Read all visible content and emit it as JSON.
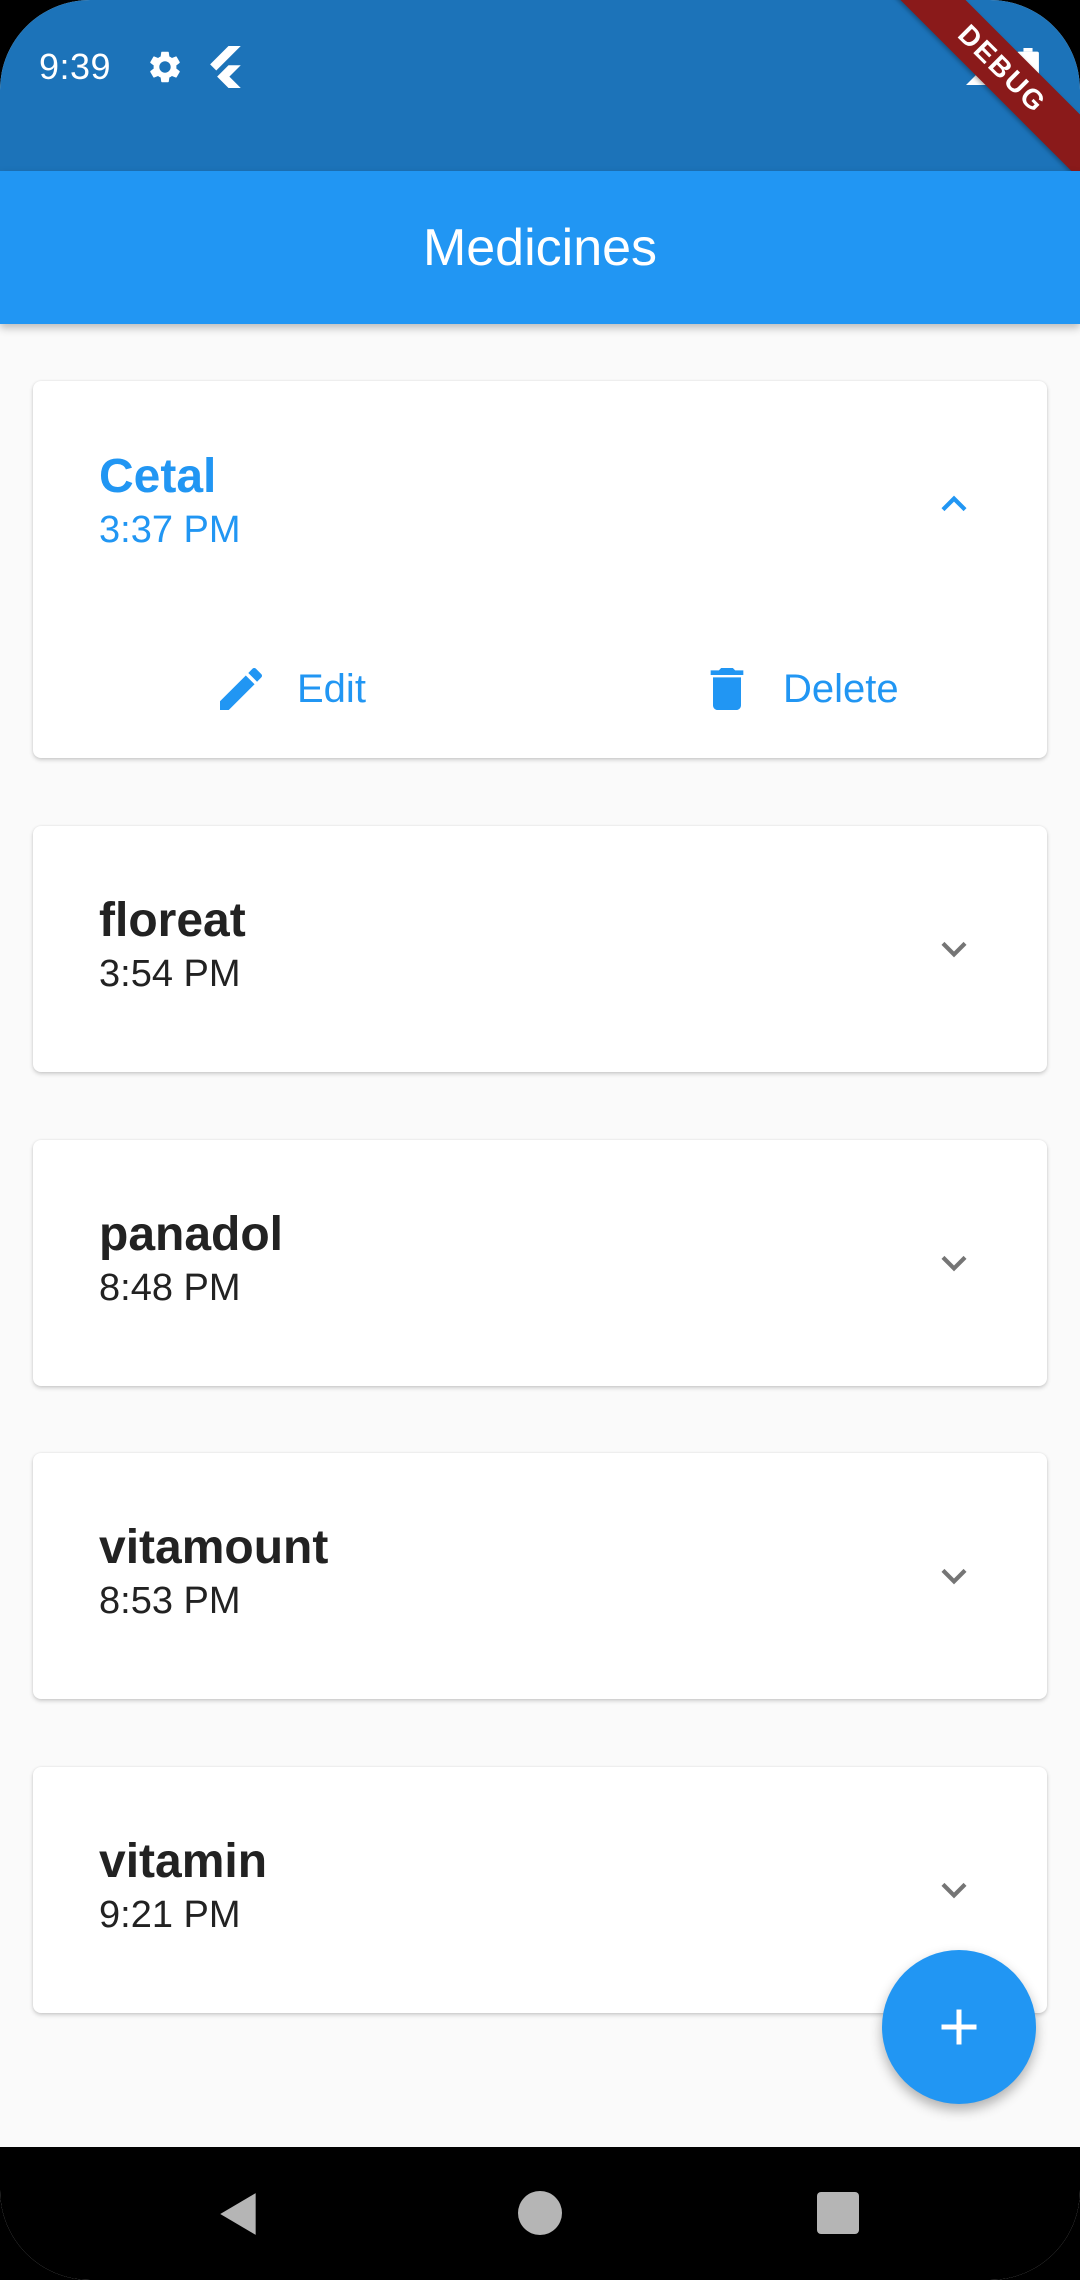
{
  "status_bar": {
    "time": "9:39",
    "icons": [
      "gear-icon",
      "flutter-icon",
      "signal-icon",
      "battery-icon"
    ],
    "debug_label": "DEBUG",
    "background": "#1c73b9"
  },
  "app_bar": {
    "title": "Medicines",
    "background": "#2196f3"
  },
  "medicines": [
    {
      "name": "Cetal",
      "time": "3:37 PM",
      "expanded": true,
      "actions": [
        {
          "label": "Edit",
          "icon": "pencil-icon"
        },
        {
          "label": "Delete",
          "icon": "trash-icon"
        }
      ]
    },
    {
      "name": "floreat",
      "time": "3:54 PM",
      "expanded": false
    },
    {
      "name": "panadol",
      "time": "8:48 PM",
      "expanded": false
    },
    {
      "name": "vitamount",
      "time": "8:53 PM",
      "expanded": false
    },
    {
      "name": "vitamin",
      "time": "9:21 PM",
      "expanded": false
    }
  ],
  "fab": {
    "icon": "plus-icon"
  },
  "nav_bar": {
    "icons": [
      "back-icon",
      "home-icon",
      "recents-icon"
    ]
  },
  "colors": {
    "accent": "#2196f3",
    "text": "#222222",
    "background": "#fafafa"
  }
}
